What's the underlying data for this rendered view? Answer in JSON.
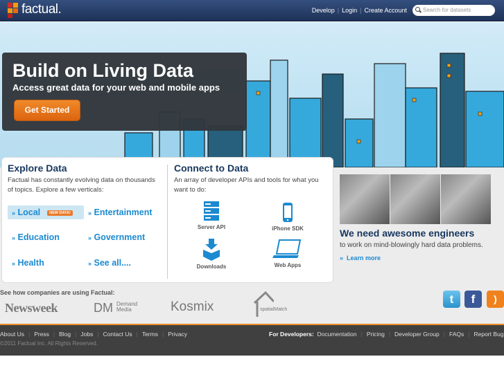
{
  "header": {
    "logo": "factual.",
    "nav": [
      "Develop",
      "Login",
      "Create Account"
    ],
    "search_placeholder": "Search for datasets"
  },
  "hero": {
    "title": "Build on Living Data",
    "subtitle": "Access great data for your web and mobile apps",
    "cta": "Get Started"
  },
  "explore": {
    "title": "Explore Data",
    "desc": "Factual has constantly evolving data on thousands of topics. Explore a few verticals:",
    "raquo": "»",
    "badge": "NEW DATA!",
    "verticals": [
      "Local",
      "Entertainment",
      "Education",
      "Government",
      "Health",
      "See all...."
    ]
  },
  "connect": {
    "title": "Connect to Data",
    "desc": "An array of developer APIs and tools for what you want to do:",
    "tools": [
      "Server API",
      "iPhone SDK",
      "Downloads",
      "Web Apps"
    ]
  },
  "jobs": {
    "title": "We need awesome engineers",
    "subtitle": "to work on mind-blowingly hard data problems.",
    "link": "Learn more",
    "raquo": "»"
  },
  "customers": {
    "heading": "See how companies are using Factual:",
    "logos": [
      "Newsweek",
      "DM",
      "Demand Media",
      "Kosmix",
      "spatialMatch"
    ]
  },
  "social": [
    "twitter",
    "facebook",
    "rss"
  ],
  "footer": {
    "links": [
      "About Us",
      "Press",
      "Blog",
      "Jobs",
      "Contact Us",
      "Terms",
      "Privacy"
    ],
    "dev_label": "For Developers:",
    "dev_links": [
      "Documentation",
      "Pricing",
      "Developer Group",
      "FAQs",
      "Report Bug"
    ],
    "copyright": "©2011 Factual Inc. All Rights Reserved."
  },
  "colors": {
    "header": "#2b4069",
    "accent": "#e97a2a",
    "link": "#1b8ad0",
    "title": "#17375e"
  }
}
